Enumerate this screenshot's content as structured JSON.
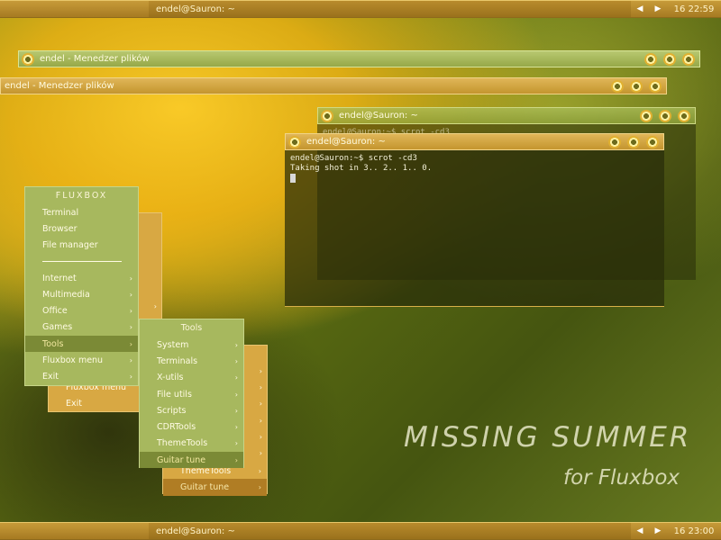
{
  "top_toolbar": {
    "title": "endel@Sauron: ~",
    "prev": "◀",
    "next": "▶",
    "clock": "16 22:59"
  },
  "bottom_toolbar": {
    "title": "endel@Sauron: ~",
    "prev": "◀",
    "next": "▶",
    "clock": "16 23:00"
  },
  "file_manager_green": {
    "title": "endel - Menedzer plików"
  },
  "file_manager_orange": {
    "title": "endel - Menedzer plików"
  },
  "terminal_ghost": {
    "title": "endel@Sauron: ~",
    "fragment": "endel@Sauron:~$ scrot -cd3"
  },
  "terminal": {
    "title": "endel@Sauron: ~",
    "line1": "endel@Sauron:~$ scrot -cd3",
    "line2": "Taking shot in 3.. 2.. 1.. 0."
  },
  "root_menu": {
    "title": "FLUXBOX",
    "items": [
      "Terminal",
      "Browser",
      "File manager"
    ],
    "sub_items": [
      "Internet",
      "Multimedia",
      "Office",
      "Games",
      "Tools",
      "Fluxbox menu",
      "Exit"
    ],
    "selected": "Tools"
  },
  "root_menu_shadow": {
    "items": [
      "Fluxbox menu",
      "Exit"
    ]
  },
  "tools_menu": {
    "title": "Tools",
    "items": [
      "System",
      "Terminals",
      "X-utils",
      "File utils",
      "Scripts",
      "CDRTools",
      "ThemeTools",
      "Guitar tune"
    ],
    "selected": "Guitar tune"
  },
  "tools_menu_shadow": {
    "items": [
      "ThemeTools",
      "Guitar tune"
    ]
  },
  "branding": {
    "line1": "MISSING SUMMER",
    "line2": "for Fluxbox"
  },
  "icons": {
    "window_button": "gear-icon",
    "submenu": "arrow-right-icon"
  },
  "colors": {
    "accent_orange": "#d8a843",
    "accent_green": "#a7b85e"
  }
}
